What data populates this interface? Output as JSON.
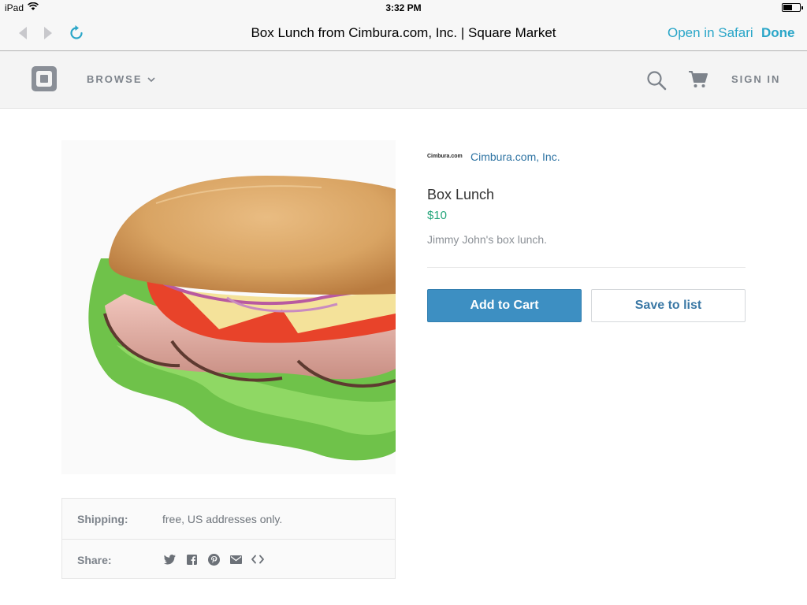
{
  "status_bar": {
    "device": "iPad",
    "time": "3:32 PM"
  },
  "browser": {
    "title": "Box Lunch from Cimbura.com, Inc. | Square Market",
    "open_in_safari": "Open in Safari",
    "done": "Done",
    "icons": [
      "back-arrow-icon",
      "forward-arrow-icon",
      "reload-icon"
    ]
  },
  "site_header": {
    "browse_label": "BROWSE",
    "sign_in_label": "SIGN IN",
    "icons": [
      "square-logo-icon",
      "chevron-down-icon",
      "search-icon",
      "cart-icon"
    ]
  },
  "seller": {
    "logo_text": "Cimbura.com",
    "name": "Cimbura.com, Inc."
  },
  "product": {
    "name": "Box Lunch",
    "price": "$10",
    "description": "Jimmy John's box lunch.",
    "image": "sandwich"
  },
  "actions": {
    "add_to_cart": "Add to Cart",
    "save_to_list": "Save to list"
  },
  "details": {
    "shipping_label": "Shipping:",
    "shipping_value": "free, US addresses only.",
    "share_label": "Share:",
    "share_icons": [
      "twitter-icon",
      "facebook-icon",
      "pinterest-icon",
      "email-icon",
      "embed-code-icon"
    ]
  },
  "colors": {
    "accent": "#2aa6c8",
    "button_primary": "#3d8fc2",
    "price": "#27a67c",
    "link": "#2f74a3"
  }
}
